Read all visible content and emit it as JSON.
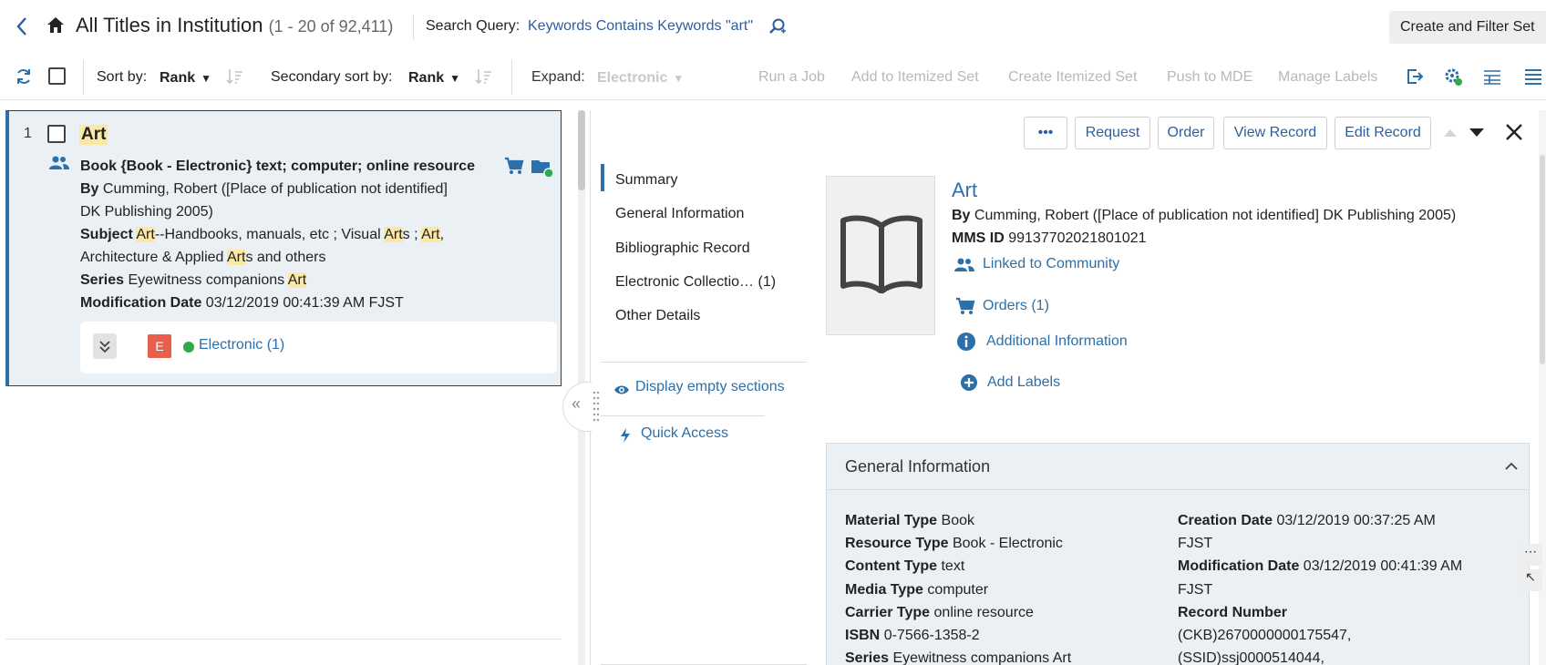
{
  "header": {
    "title": "All Titles in Institution",
    "count": "(1 - 20 of 92,411)",
    "search_query_label": "Search Query:",
    "search_query_value": "Keywords Contains Keywords \"art\"",
    "create_filter_button": "Create and Filter Set"
  },
  "toolbar": {
    "sort_by_label": "Sort by:",
    "sort_by_value": "Rank",
    "secondary_sort_label": "Secondary sort by:",
    "secondary_sort_value": "Rank",
    "expand_label": "Expand:",
    "expand_value": "Electronic",
    "actions": {
      "run_job": "Run a Job",
      "add_itemized": "Add to Itemized Set",
      "create_itemized": "Create Itemized Set",
      "push_mde": "Push to MDE",
      "manage_labels": "Manage Labels"
    }
  },
  "result": {
    "index": "1",
    "title": "Art",
    "format_line": "Book {Book - Electronic} text; computer; online resource",
    "by_label": "By",
    "by_value_1": "Cumming, Robert ([Place of publication not identified]",
    "by_value_2": "DK Publishing 2005)",
    "subject_label": "Subject",
    "subject_parts": [
      "Art",
      "--Handbooks, manuals, etc ; Visual ",
      "Art",
      "s ; ",
      "Art",
      ","
    ],
    "subject_line2_parts": [
      "Architecture & Applied ",
      "Art",
      "s and others"
    ],
    "series_label": "Series",
    "series_value": "Eyewitness companions ",
    "series_highlight": "Art",
    "mod_date_label": "Modification Date",
    "mod_date_value": "03/12/2019 00:41:39 AM FJST",
    "badge_letter": "E",
    "electronic_link": "Electronic (1)"
  },
  "detail": {
    "buttons": {
      "more": "•••",
      "request": "Request",
      "order": "Order",
      "view_record": "View Record",
      "edit_record": "Edit Record"
    },
    "sidenav": [
      "Summary",
      "General Information",
      "Bibliographic Record",
      "Electronic Collectio… (1)",
      "Other Details"
    ],
    "display_empty": "Display empty sections",
    "quick_access": "Quick Access",
    "record_title": "Art",
    "by_label": "By",
    "by_value": "Cumming, Robert ([Place of publication not identified] DK Publishing 2005)",
    "mms_label": "MMS ID",
    "mms_value": "99137702021801021",
    "linked_community": "Linked to Community",
    "orders": "Orders (1)",
    "additional_info": "Additional Information",
    "add_labels": "Add Labels",
    "general_info": {
      "title": "General Information",
      "left": [
        {
          "label": "Material Type",
          "value": "Book"
        },
        {
          "label": "Resource Type",
          "value": "Book - Electronic"
        },
        {
          "label": "Content Type",
          "value": "text"
        },
        {
          "label": "Media Type",
          "value": "computer"
        },
        {
          "label": "Carrier Type",
          "value": "online resource"
        },
        {
          "label": "ISBN",
          "value": "0-7566-1358-2"
        },
        {
          "label": "Series",
          "value": "Eyewitness companions Art"
        }
      ],
      "right": {
        "creation_label": "Creation Date",
        "creation_value": "03/12/2019 00:37:25 AM",
        "creation_tz": "FJST",
        "modification_label": "Modification Date",
        "modification_value": "03/12/2019 00:41:39 AM",
        "modification_tz": "FJST",
        "record_number_label": "Record Number",
        "record_number_1": "(CKB)2670000000175547,",
        "record_number_2": "(SSID)ssj0000514044,"
      }
    }
  },
  "colors": {
    "link": "#2d6fa8",
    "highlight": "#fbe7a6",
    "card_bg": "#eaf0f3",
    "badge_e": "#e8604c",
    "status_green": "#2eaa4b"
  },
  "icons": [
    "back-icon",
    "home-icon",
    "search-query-icon",
    "refresh-icon",
    "sort-direction-icon",
    "export-icon",
    "settings-icon",
    "columns-icon",
    "list-icon",
    "people-icon",
    "cart-icon",
    "folder-icon",
    "book-icon",
    "info-icon",
    "plus-icon",
    "eye-icon",
    "bolt-icon",
    "close-icon"
  ]
}
